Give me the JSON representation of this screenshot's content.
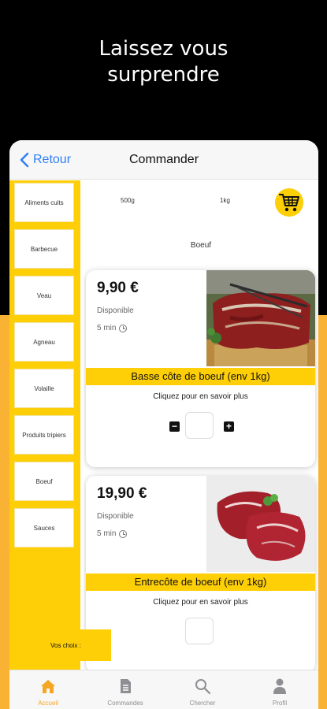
{
  "hero": {
    "line1": "Laissez vous",
    "line2": "surprendre"
  },
  "navbar": {
    "back_label": "Retour",
    "title": "Commander"
  },
  "sidebar": {
    "items": [
      {
        "label": "Aliments cuits"
      },
      {
        "label": "Barbecue"
      },
      {
        "label": "Veau"
      },
      {
        "label": "Agneau"
      },
      {
        "label": "Volaille"
      },
      {
        "label": "Produits tripiers"
      },
      {
        "label": "Boeuf"
      },
      {
        "label": "Sauces"
      }
    ]
  },
  "content": {
    "formats": [
      "500g",
      "1kg"
    ],
    "section_title": "Boeuf",
    "cart_icon": "shopping-cart-icon",
    "products": [
      {
        "price": "9,90 €",
        "status": "Disponible",
        "time": "5 min",
        "name": "Basse côte de boeuf (env 1kg)",
        "more": "Cliquez pour en savoir plus"
      },
      {
        "price": "19,90 €",
        "status": "Disponible",
        "time": "5 min",
        "name": "Entrecôte de boeuf (env 1kg)",
        "more": "Cliquez pour en savoir plus"
      }
    ],
    "choices_label": "Vos choix :"
  },
  "tabbar": {
    "items": [
      {
        "label": "Accueil",
        "icon": "home-icon"
      },
      {
        "label": "Commandes",
        "icon": "document-icon"
      },
      {
        "label": "Chercher",
        "icon": "search-icon"
      },
      {
        "label": "Profil",
        "icon": "person-icon"
      }
    ]
  },
  "colors": {
    "accent_yellow": "#fecf06",
    "orange_bg": "#f9b233",
    "link_blue": "#2f7ff5"
  }
}
